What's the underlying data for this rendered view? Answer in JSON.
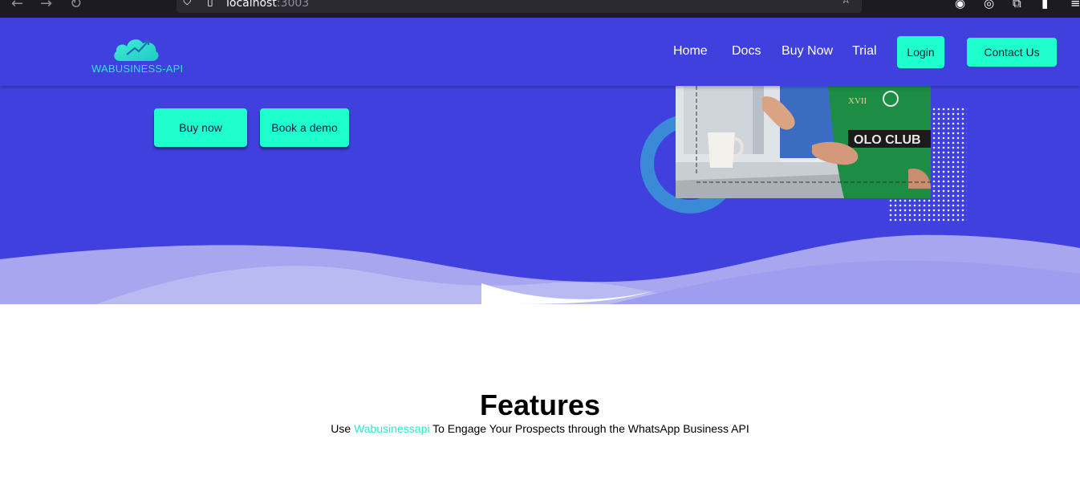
{
  "browser": {
    "url_host": "localhost",
    "url_port": ":3003",
    "back_icon": "arrow-left",
    "forward_icon": "arrow-right",
    "reload_icon": "reload",
    "bookmark_icon": "star"
  },
  "header": {
    "logo_text": "WABUSINESS-API",
    "nav": [
      "Home",
      "Docs",
      "Buy Now",
      "Trial"
    ],
    "login_label": "Login",
    "contact_label": "Contact Us"
  },
  "hero": {
    "buy_label": "Buy now",
    "demo_label": "Book a demo"
  },
  "features": {
    "title": "Features",
    "subtitle_prefix": "Use ",
    "subtitle_brand": "Wabusinessapi",
    "subtitle_suffix": " To Engage Your Prospects through the WhatsApp Business API"
  },
  "colors": {
    "primary": "#4040df",
    "accent": "#1fffce",
    "brand_text": "#2ee6cf"
  }
}
